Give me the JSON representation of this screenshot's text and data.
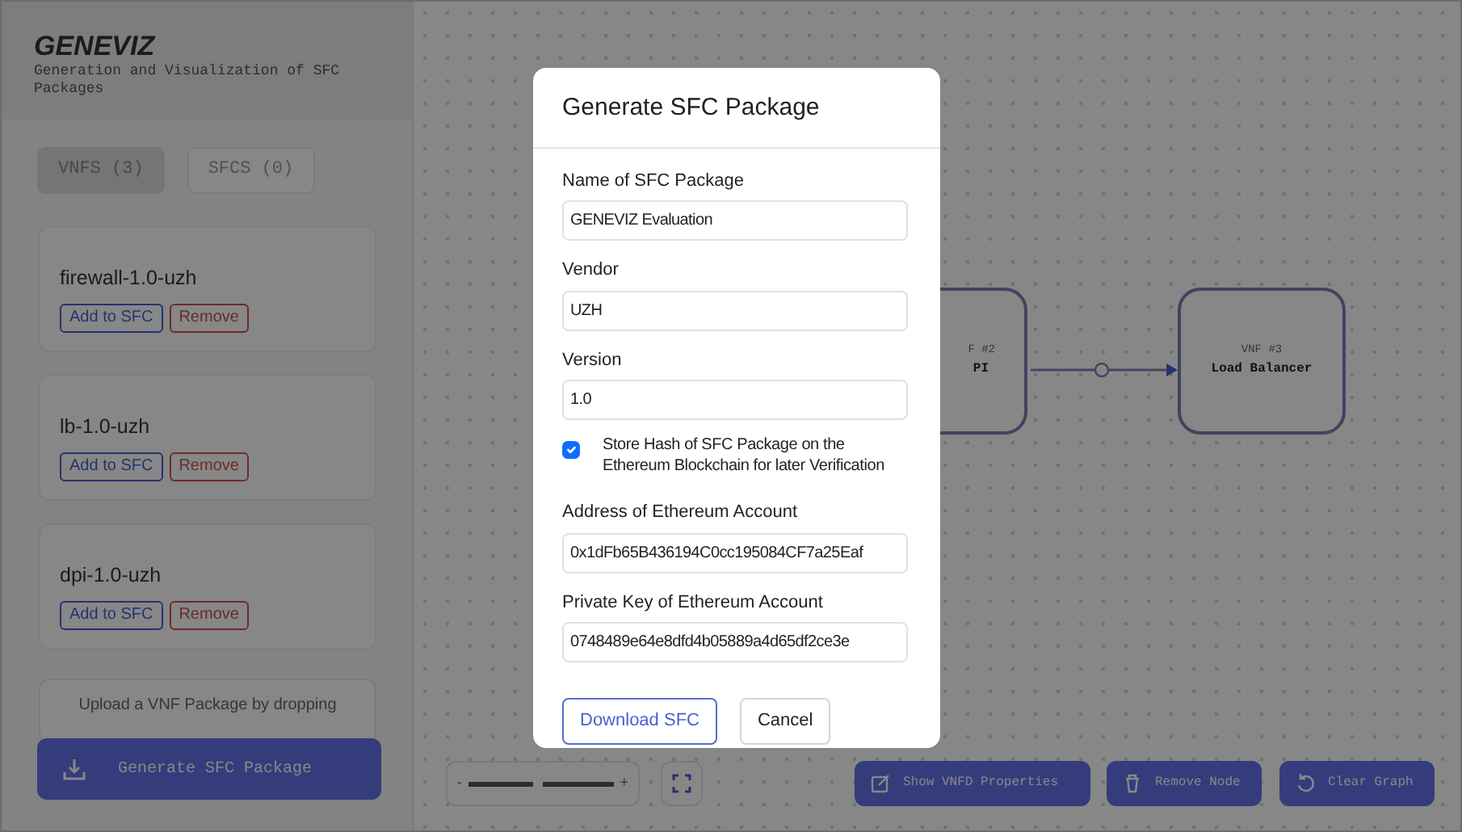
{
  "app": {
    "title": "GENEVIZ",
    "subtitle": "Generation and Visualization of SFC Packages"
  },
  "tabs": [
    {
      "label": "VNFS (3)",
      "selected": true
    },
    {
      "label": "SFCS (0)",
      "selected": false
    }
  ],
  "vnfs": [
    {
      "name": "firewall-1.0-uzh",
      "add": "Add to SFC",
      "remove": "Remove"
    },
    {
      "name": "lb-1.0-uzh",
      "add": "Add to SFC",
      "remove": "Remove"
    },
    {
      "name": "dpi-1.0-uzh",
      "add": "Add to SFC",
      "remove": "Remove"
    }
  ],
  "upload_hint": "Upload a VNF Package by dropping",
  "generate_button": "Generate SFC Package",
  "graph": {
    "nodes": [
      {
        "number": "F #2",
        "label": "PI"
      },
      {
        "number": "VNF #3",
        "label": "Load Balancer"
      }
    ]
  },
  "zoom": {
    "minus": "-",
    "plus": "+",
    "level": 0.45
  },
  "toolbar": [
    {
      "kind": "edit",
      "label": "Show VNFD Properties"
    },
    {
      "kind": "trash",
      "label": "Remove Node"
    },
    {
      "kind": "reset",
      "label": "Clear Graph"
    }
  ],
  "modal": {
    "title": "Generate SFC Package",
    "fields": [
      {
        "label": "Name of SFC Package",
        "value": "GENEVIZ Evaluation"
      },
      {
        "label": "Vendor",
        "value": "UZH"
      },
      {
        "label": "Version",
        "value": "1.0"
      }
    ],
    "checkbox": {
      "label": "Store Hash of SFC Package on the Ethereum Blockchain for later Verification",
      "checked": true
    },
    "eth_fields": [
      {
        "label": "Address of Ethereum Account",
        "value": "0x1dFb65B436194C0cc195084CF7a25Eaf"
      },
      {
        "label": "Private Key of Ethereum Account",
        "value": "0748489e64e8dfd4b05889a4d65df2ce3e"
      }
    ],
    "buttons": [
      {
        "label": "Download SFC",
        "kind": "primary"
      },
      {
        "label": "Cancel",
        "kind": "secondary"
      }
    ]
  }
}
